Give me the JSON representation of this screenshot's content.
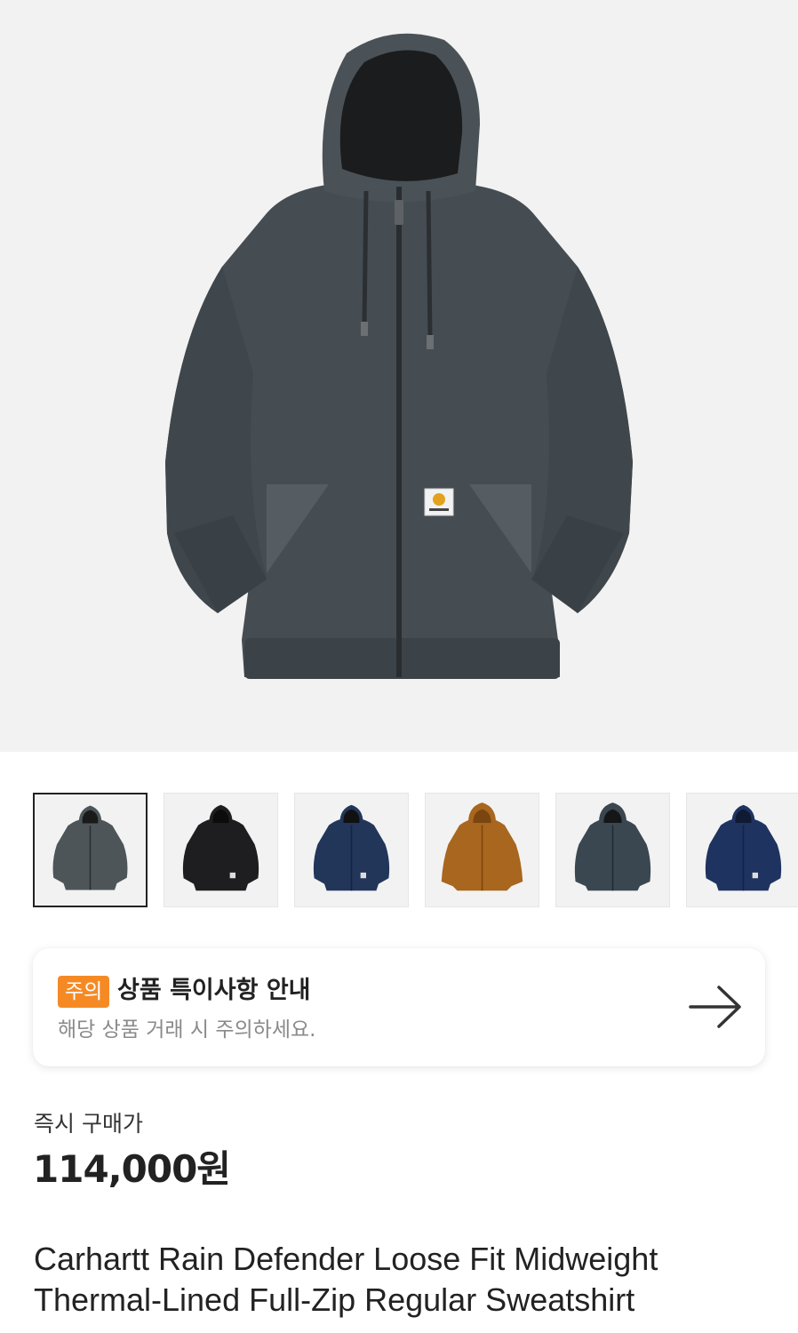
{
  "hero_image": {
    "icon": "hoodie-image",
    "color": "#454d53"
  },
  "thumbnails": [
    {
      "name": "thumb-gray",
      "color": "#4d5559",
      "selected": true
    },
    {
      "name": "thumb-black",
      "color": "#1e1e20",
      "selected": false
    },
    {
      "name": "thumb-navy",
      "color": "#22365a",
      "selected": false
    },
    {
      "name": "thumb-brown",
      "color": "#a8661e",
      "selected": false
    },
    {
      "name": "thumb-slate",
      "color": "#3b4750",
      "selected": false
    },
    {
      "name": "thumb-navy-2",
      "color": "#1f3360",
      "selected": false
    }
  ],
  "notice": {
    "badge": "주의",
    "title": "상품 특이사항 안내",
    "description": "해당 상품 거래 시 주의하세요.",
    "badge_color": "#f58a25",
    "arrow_icon": "arrow-right-icon"
  },
  "price": {
    "label": "즉시 구매가",
    "value": "114,000원"
  },
  "product": {
    "name_line1": "Carhartt Rain Defender Loose Fit Midweight",
    "name_line2": "Thermal-Lined Full-Zip Regular Sweatshirt"
  }
}
